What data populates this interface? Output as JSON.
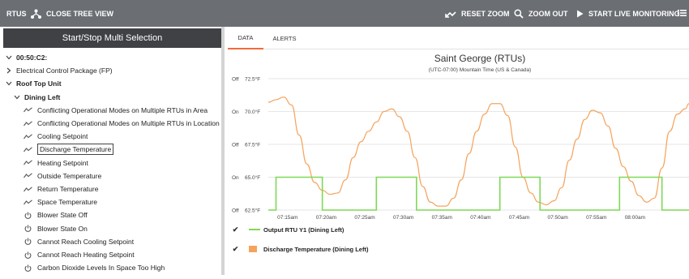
{
  "toolbar": {
    "title": "RTUS",
    "close_tree": "CLOSE TREE VIEW",
    "reset_zoom": "RESET ZOOM",
    "zoom_out": "ZOOM OUT",
    "live": "START LIVE MONITORING"
  },
  "left": {
    "multi_selection": "Start/Stop Multi Selection",
    "tree": [
      {
        "label": "00:50:C2:",
        "level": 0,
        "caret": "down",
        "bold": true,
        "icon": ""
      },
      {
        "label": "Electrical Control Package (FP)",
        "level": 1,
        "caret": "right",
        "bold": false,
        "icon": ""
      },
      {
        "label": "Roof Top Unit",
        "level": 1,
        "caret": "down",
        "bold": true,
        "icon": ""
      },
      {
        "label": "Dining Left",
        "level": 2,
        "caret": "down",
        "bold": true,
        "icon": ""
      },
      {
        "label": "Conflicting Operational Modes on Multiple RTUs in Area",
        "level": 3,
        "caret": "",
        "bold": false,
        "icon": "trend-icon"
      },
      {
        "label": "Conflicting Operational Modes on Multiple RTUs in Location",
        "level": 3,
        "caret": "",
        "bold": false,
        "icon": "trend-icon"
      },
      {
        "label": "Cooling Setpoint",
        "level": 3,
        "caret": "",
        "bold": false,
        "icon": "trend-icon"
      },
      {
        "label": "Discharge Temperature",
        "level": 3,
        "caret": "",
        "bold": false,
        "icon": "trend-icon",
        "selected": true
      },
      {
        "label": "Heating Setpoint",
        "level": 3,
        "caret": "",
        "bold": false,
        "icon": "trend-icon"
      },
      {
        "label": "Outside Temperature",
        "level": 3,
        "caret": "",
        "bold": false,
        "icon": "trend-icon"
      },
      {
        "label": "Return Temperature",
        "level": 3,
        "caret": "",
        "bold": false,
        "icon": "trend-icon"
      },
      {
        "label": "Space Temperature",
        "level": 3,
        "caret": "",
        "bold": false,
        "icon": "trend-icon"
      },
      {
        "label": "Blower State Off",
        "level": 3,
        "caret": "",
        "bold": false,
        "icon": "power-icon"
      },
      {
        "label": "Blower State On",
        "level": 3,
        "caret": "",
        "bold": false,
        "icon": "power-icon"
      },
      {
        "label": "Cannot Reach Cooling Setpoint",
        "level": 3,
        "caret": "",
        "bold": false,
        "icon": "power-icon"
      },
      {
        "label": "Cannot Reach Heating Setpoint",
        "level": 3,
        "caret": "",
        "bold": false,
        "icon": "power-icon"
      },
      {
        "label": "Carbon Dioxide Levels In Space Too High",
        "level": 3,
        "caret": "",
        "bold": false,
        "icon": "power-icon"
      }
    ]
  },
  "tabs": [
    "DATA",
    "ALERTS"
  ],
  "colors": {
    "toolbar": "#6b6f74",
    "accent": "#f26b3a",
    "discharge": "#f5a35c",
    "output": "#7ed957"
  },
  "legend": {
    "output": "Output RTU Y1 (Dining Left)",
    "discharge": "Discharge Temperature (Dining Left)"
  },
  "chart_data": {
    "type": "line",
    "title": "Saint George (RTUs)",
    "subtitle": "(UTC-07:00) Mountain Time (US & Canada)",
    "y_ticks": [
      {
        "state": "Off",
        "temp": "72.5°F",
        "value": 72.5
      },
      {
        "state": "On",
        "temp": "70.0°F",
        "value": 70.0
      },
      {
        "state": "Off",
        "temp": "67.5°F",
        "value": 67.5
      },
      {
        "state": "On",
        "temp": "65.0°F",
        "value": 65.0
      },
      {
        "state": "Off",
        "temp": "62.5°F",
        "value": 62.5
      }
    ],
    "ylim": [
      62.5,
      72.5
    ],
    "x_ticks": [
      "07:15am",
      "07:20am",
      "07:25am",
      "07:30am",
      "07:35am",
      "07:40am",
      "07:45am",
      "07:50am",
      "07:55am",
      "08:00am"
    ],
    "xlim_minutes": [
      0,
      54.5
    ],
    "x_tick_minutes": [
      2.5,
      7.5,
      12.5,
      17.5,
      22.5,
      27.5,
      32.5,
      37.5,
      42.5,
      47.5
    ],
    "series": [
      {
        "name": "Discharge Temperature (Dining Left)",
        "kind": "temperature",
        "points": [
          [
            0,
            70.7
          ],
          [
            1,
            70.9
          ],
          [
            2,
            71.1
          ],
          [
            3,
            70.5
          ],
          [
            4,
            68.2
          ],
          [
            5,
            66.0
          ],
          [
            6,
            64.6
          ],
          [
            7,
            64.0
          ],
          [
            8,
            63.7
          ],
          [
            9,
            63.8
          ],
          [
            10,
            64.8
          ],
          [
            11,
            66.5
          ],
          [
            12,
            67.7
          ],
          [
            13,
            68.5
          ],
          [
            14,
            69.2
          ],
          [
            15,
            70.0
          ],
          [
            16,
            70.2
          ],
          [
            17,
            69.6
          ],
          [
            18,
            68.5
          ],
          [
            19,
            66.5
          ],
          [
            20,
            64.3
          ],
          [
            21,
            63.1
          ],
          [
            22,
            62.8
          ],
          [
            23,
            62.8
          ],
          [
            24,
            63.4
          ],
          [
            25,
            64.8
          ],
          [
            26,
            66.8
          ],
          [
            27,
            68.5
          ],
          [
            28,
            69.8
          ],
          [
            29,
            70.6
          ],
          [
            30,
            70.6
          ],
          [
            31,
            69.7
          ],
          [
            32,
            67.3
          ],
          [
            33,
            65.0
          ],
          [
            34,
            63.8
          ],
          [
            35,
            63.1
          ],
          [
            36,
            62.9
          ],
          [
            37,
            63.2
          ],
          [
            38,
            64.2
          ],
          [
            39,
            66.3
          ],
          [
            40,
            67.9
          ],
          [
            41,
            69.4
          ],
          [
            42,
            70.1
          ],
          [
            43,
            69.9
          ],
          [
            44,
            68.9
          ],
          [
            45,
            67.2
          ],
          [
            46,
            65.8
          ],
          [
            47,
            64.7
          ],
          [
            48,
            63.6
          ],
          [
            49,
            63.1
          ],
          [
            50,
            63.4
          ],
          [
            51,
            65.7
          ],
          [
            52,
            68.5
          ],
          [
            53,
            69.8
          ],
          [
            54,
            70.2
          ],
          [
            54.5,
            70.6
          ]
        ]
      },
      {
        "name": "Output RTU Y1 (Dining Left)",
        "kind": "state",
        "on_value": 65.0,
        "off_value": 62.5,
        "points": [
          [
            0,
            62.5
          ],
          [
            1,
            62.5
          ],
          [
            1,
            65.0
          ],
          [
            7,
            65.0
          ],
          [
            7,
            62.5
          ],
          [
            14,
            62.5
          ],
          [
            14,
            65.0
          ],
          [
            19.2,
            65.0
          ],
          [
            19.2,
            62.5
          ],
          [
            30,
            62.5
          ],
          [
            30,
            65.0
          ],
          [
            35.2,
            65.0
          ],
          [
            35.2,
            62.5
          ],
          [
            45.5,
            62.5
          ],
          [
            45.5,
            65.0
          ],
          [
            51,
            65.0
          ],
          [
            51,
            62.5
          ],
          [
            54.5,
            62.5
          ]
        ]
      }
    ]
  }
}
